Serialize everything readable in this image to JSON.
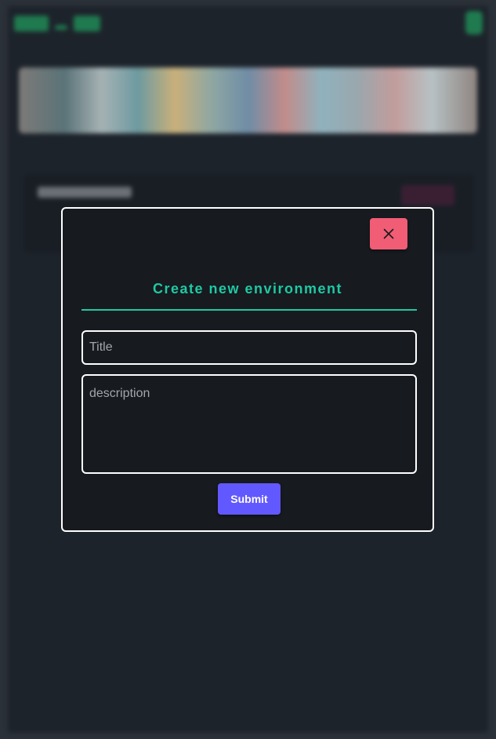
{
  "modal": {
    "title": "Create new environment",
    "close_icon": "close-icon",
    "title_field": {
      "value": "",
      "placeholder": "Title"
    },
    "description_field": {
      "value": "",
      "placeholder": "description"
    },
    "submit_label": "Submit"
  },
  "colors": {
    "accent": "#1fc9a3",
    "close_button": "#f05d75",
    "submit_button": "#6258ff",
    "modal_background": "#171a1f",
    "page_background": "#1d232b"
  }
}
